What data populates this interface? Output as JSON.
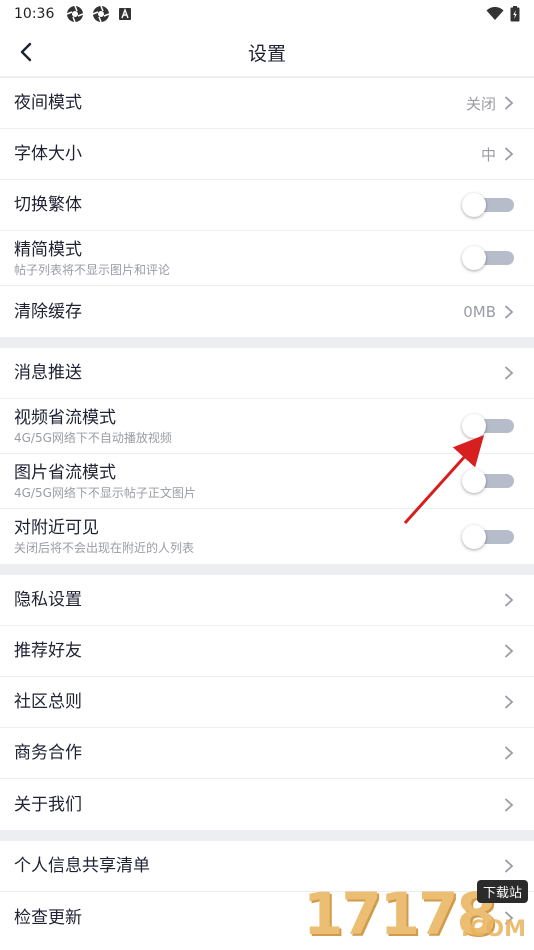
{
  "status_bar": {
    "time": "10:36"
  },
  "header": {
    "title": "设置"
  },
  "groups": [
    {
      "items": [
        {
          "label": "夜间模式",
          "value": "关闭",
          "type": "chevron"
        },
        {
          "label": "字体大小",
          "value": "中",
          "type": "chevron"
        },
        {
          "label": "切换繁体",
          "type": "toggle",
          "on": false
        },
        {
          "label": "精简模式",
          "sub": "帖子列表将不显示图片和评论",
          "type": "toggle",
          "on": false
        },
        {
          "label": "清除缓存",
          "value": "0MB",
          "type": "chevron"
        }
      ]
    },
    {
      "items": [
        {
          "label": "消息推送",
          "type": "chevron"
        },
        {
          "label": "视频省流模式",
          "sub": "4G/5G网络下不自动播放视频",
          "type": "toggle",
          "on": false
        },
        {
          "label": "图片省流模式",
          "sub": "4G/5G网络下不显示帖子正文图片",
          "type": "toggle",
          "on": false
        },
        {
          "label": "对附近可见",
          "sub": "关闭后将不会出现在附近的人列表",
          "type": "toggle",
          "on": false
        }
      ]
    },
    {
      "items": [
        {
          "label": "隐私设置",
          "type": "chevron"
        },
        {
          "label": "推荐好友",
          "type": "chevron"
        },
        {
          "label": "社区总则",
          "type": "chevron"
        },
        {
          "label": "商务合作",
          "type": "chevron"
        },
        {
          "label": "关于我们",
          "type": "chevron"
        }
      ]
    },
    {
      "items": [
        {
          "label": "个人信息共享清单",
          "type": "chevron"
        },
        {
          "label": "检查更新",
          "type": "chevron"
        }
      ]
    }
  ],
  "watermark": {
    "digits": "17178",
    "badge": "下载站",
    "suffix": ".COM"
  },
  "colors": {
    "accent_text": "#1f2233",
    "secondary_text": "#9a9ca6",
    "divider": "#eceef2",
    "toggle_off": "#b7bccb",
    "annotation": "#d81f1f"
  }
}
